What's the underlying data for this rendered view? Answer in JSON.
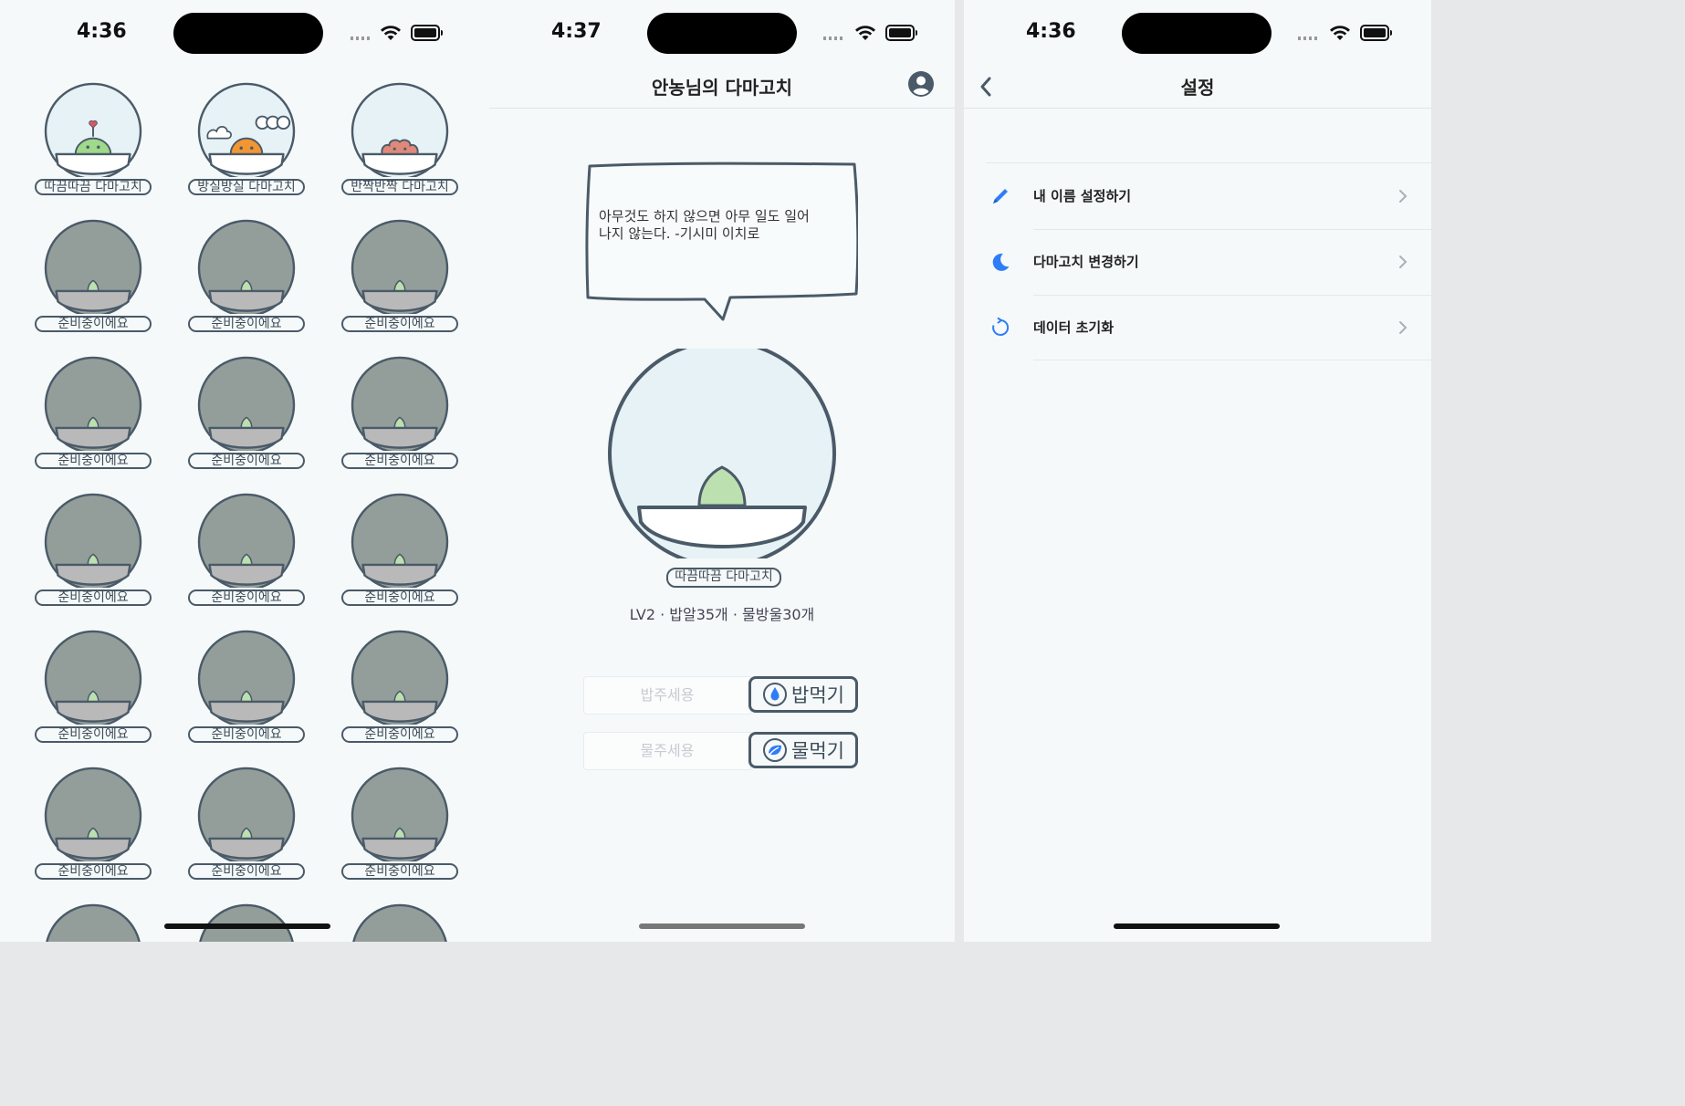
{
  "select_screen": {
    "time": "4:36",
    "items": [
      {
        "label": "따끔따끔 다마고치",
        "kind": "tamagotchi1"
      },
      {
        "label": "방실방실 다마고치",
        "kind": "tamagotchi2"
      },
      {
        "label": "반짝반짝 다마고치",
        "kind": "tamagotchi3"
      },
      {
        "label": "준비중이에요",
        "kind": "locked"
      },
      {
        "label": "준비중이에요",
        "kind": "locked"
      },
      {
        "label": "준비중이에요",
        "kind": "locked"
      },
      {
        "label": "준비중이에요",
        "kind": "locked"
      },
      {
        "label": "준비중이에요",
        "kind": "locked"
      },
      {
        "label": "준비중이에요",
        "kind": "locked"
      },
      {
        "label": "준비중이에요",
        "kind": "locked"
      },
      {
        "label": "준비중이에요",
        "kind": "locked"
      },
      {
        "label": "준비중이에요",
        "kind": "locked"
      },
      {
        "label": "준비중이에요",
        "kind": "locked"
      },
      {
        "label": "준비중이에요",
        "kind": "locked"
      },
      {
        "label": "준비중이에요",
        "kind": "locked"
      },
      {
        "label": "준비중이에요",
        "kind": "locked"
      },
      {
        "label": "준비중이에요",
        "kind": "locked"
      },
      {
        "label": "준비중이에요",
        "kind": "locked"
      },
      {
        "label": "",
        "kind": "locked"
      },
      {
        "label": "",
        "kind": "locked"
      },
      {
        "label": "",
        "kind": "locked"
      }
    ]
  },
  "main_screen": {
    "time": "4:37",
    "title": "안농님의 다마고치",
    "bubble_message": "아무것도 하지 않으면 아무 일도 일어나지 않는다. -기시미 이치로",
    "character_name": "따끔따끔 다마고치",
    "stats": "LV2 · 밥알35개 · 물방울30개",
    "food_placeholder": "밥주세용",
    "feed_button": "밥먹기",
    "water_placeholder": "물주세용",
    "water_button": "물먹기"
  },
  "settings_screen": {
    "time": "4:36",
    "title": "설정",
    "rows": [
      {
        "label": "내 이름 설정하기",
        "icon": "pencil-icon"
      },
      {
        "label": "다마고치 변경하기",
        "icon": "moon-icon"
      },
      {
        "label": "데이터 초기화",
        "icon": "reset-icon"
      }
    ]
  },
  "colors": {
    "accent": "#2f7df6",
    "outline": "#4a5a68",
    "bowl_bg": "#e6f2f5",
    "locked": "#939e9b",
    "sprout": "#bde0b0",
    "tama1": "#9fd98a",
    "tama2": "#f29633",
    "tama3": "#e0897a"
  }
}
